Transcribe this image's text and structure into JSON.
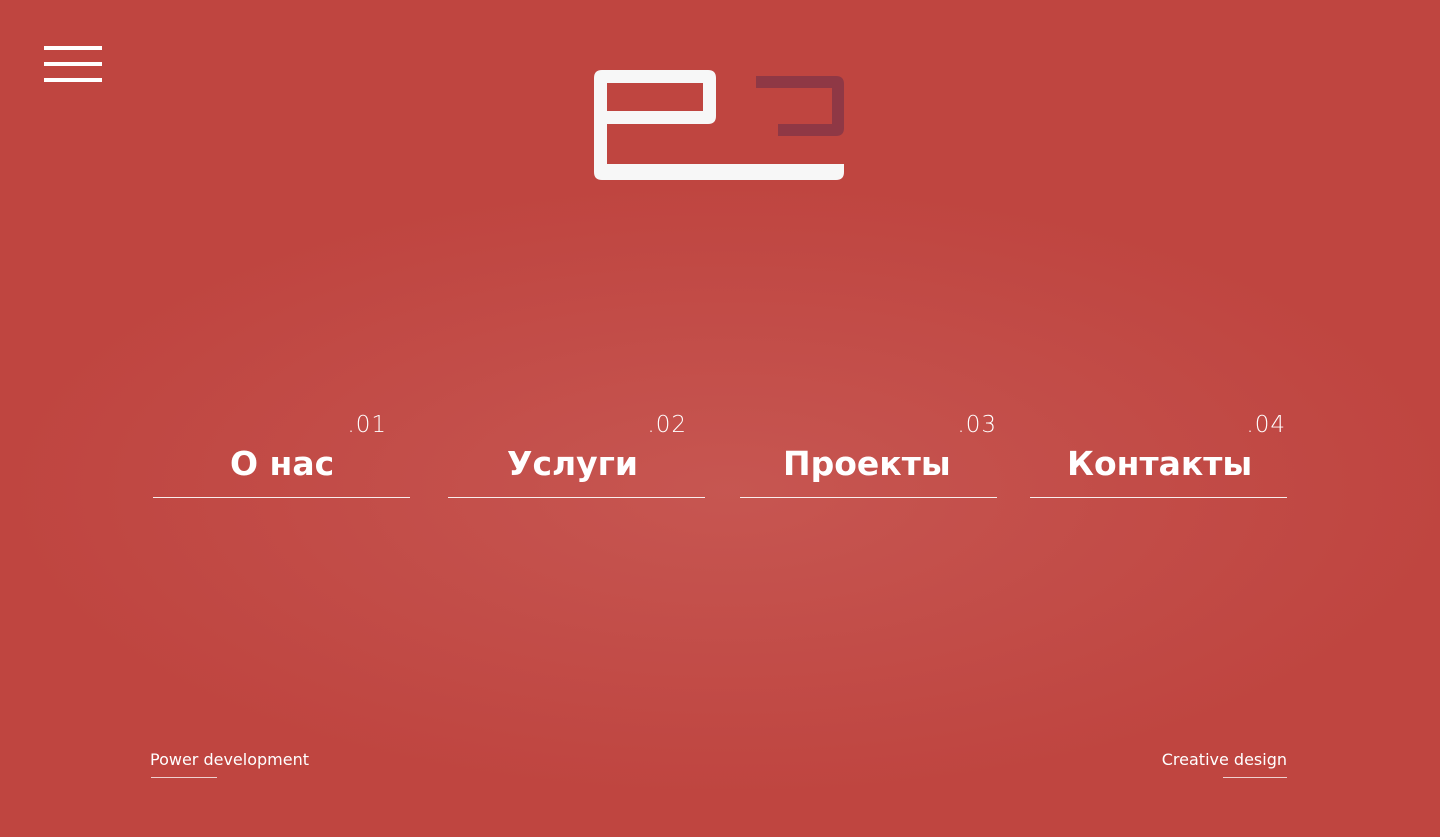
{
  "header": {
    "menu_icon": "hamburger-menu-icon",
    "logo_icon": "p2-logo-icon"
  },
  "nav": {
    "items": [
      {
        "number": ".01",
        "label": "О нас"
      },
      {
        "number": ".02",
        "label": "Услуги"
      },
      {
        "number": ".03",
        "label": "Проекты"
      },
      {
        "number": ".04",
        "label": "Контакты"
      }
    ]
  },
  "footer": {
    "left_text": "Power development",
    "right_text": "Creative design"
  },
  "colors": {
    "background": "#bf4540",
    "logo_primary": "#f7f7f7",
    "logo_accent": "#8f3845",
    "text": "#ffffff"
  }
}
